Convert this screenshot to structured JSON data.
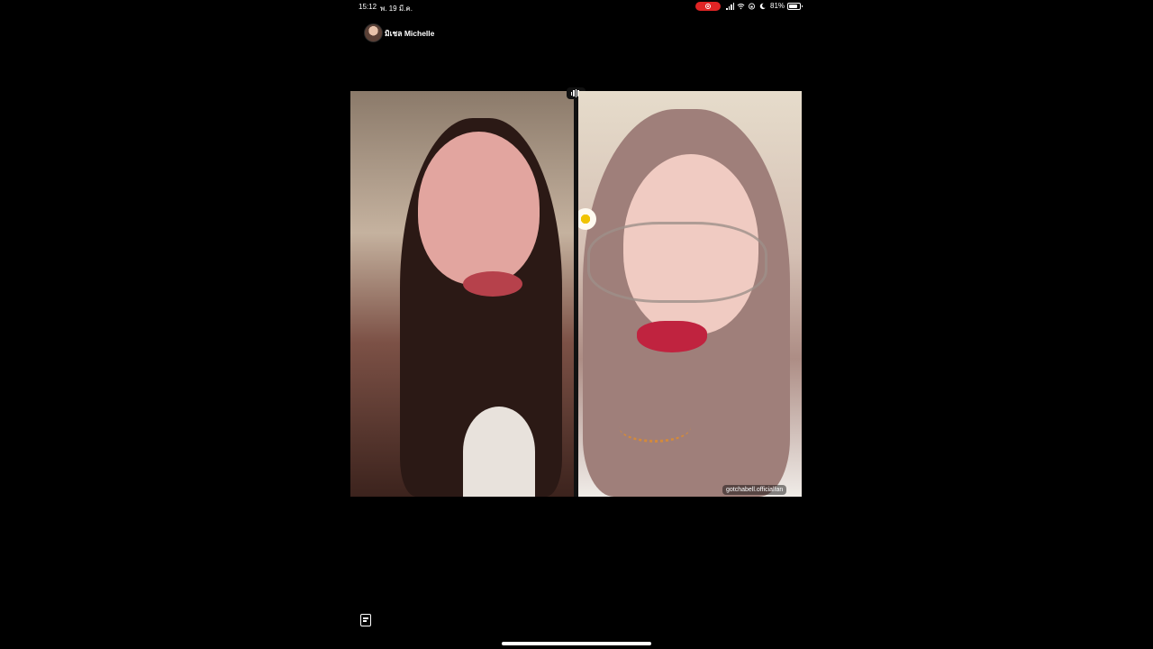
{
  "status_bar": {
    "time": "15:12",
    "date": "พ. 19 มี.ค.",
    "battery": "81%"
  },
  "live": {
    "host_name": "มิเชล Michelle",
    "watermark": "gotchabell.officialfan"
  }
}
